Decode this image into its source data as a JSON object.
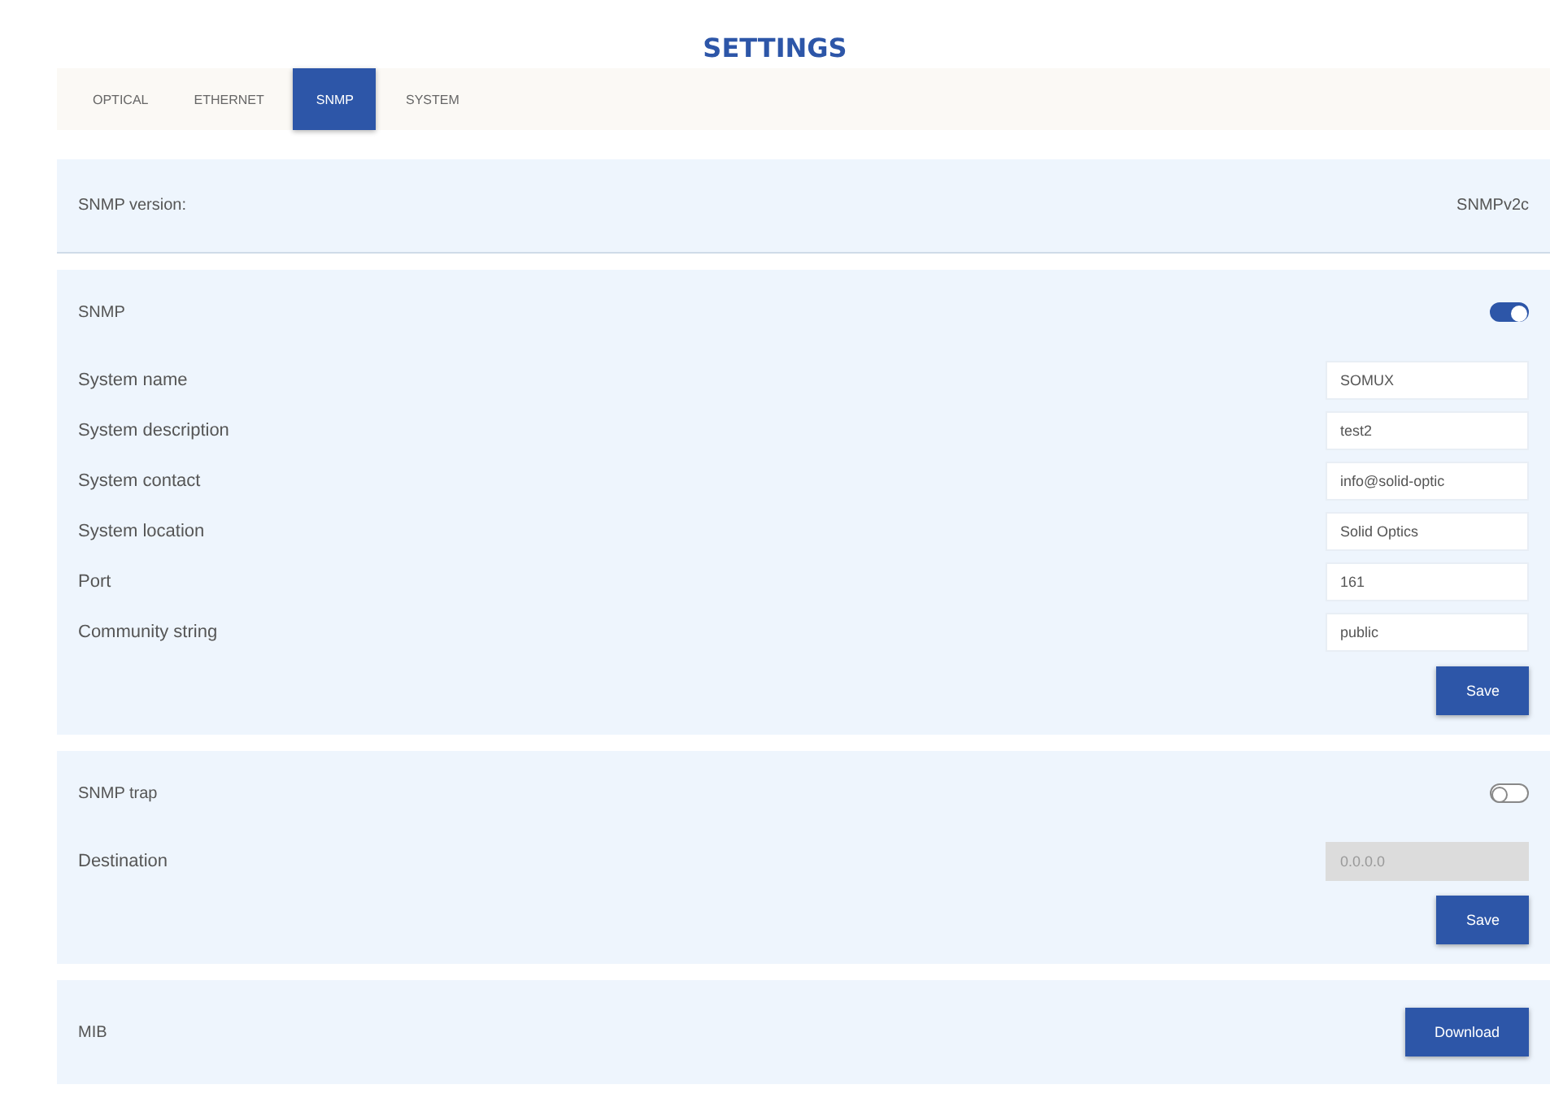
{
  "title": "SETTINGS",
  "tabs": [
    {
      "label": "OPTICAL",
      "selected": false
    },
    {
      "label": "ETHERNET",
      "selected": false
    },
    {
      "label": "SNMP",
      "selected": true
    },
    {
      "label": "SYSTEM",
      "selected": false
    }
  ],
  "version": {
    "label": "SNMP version:",
    "value": "SNMPv2c"
  },
  "snmp": {
    "label": "SNMP",
    "on": true,
    "fields": [
      {
        "label": "System name",
        "value": "SOMUX"
      },
      {
        "label": "System description",
        "value": "test2"
      },
      {
        "label": "System contact",
        "value": "info@solid-optic"
      },
      {
        "label": "System location",
        "value": "Solid Optics"
      },
      {
        "label": "Port",
        "value": "161"
      },
      {
        "label": "Community string",
        "value": "public"
      }
    ],
    "button": "Save"
  },
  "trap": {
    "label": "SNMP trap",
    "on": false,
    "fields": [
      {
        "label": "Destination",
        "value": "0.0.0.0",
        "disabled": true
      }
    ],
    "button": "Save"
  },
  "mib": {
    "label": "MIB",
    "button": "Download"
  }
}
